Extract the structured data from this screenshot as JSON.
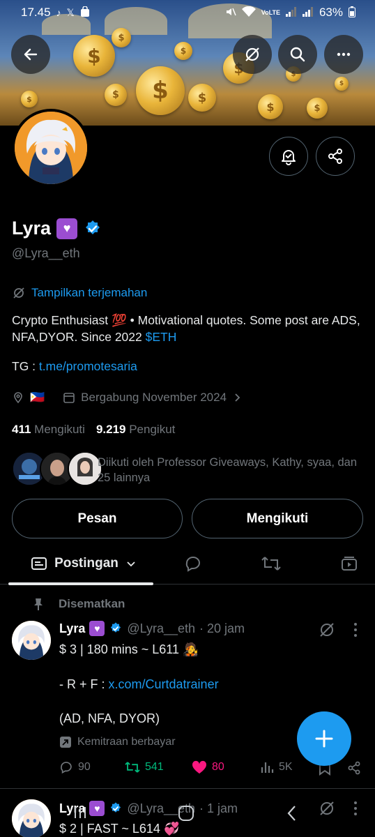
{
  "status_bar": {
    "time": "17.45",
    "battery": "63%",
    "network_label": "VoLTE"
  },
  "profile": {
    "name": "Lyra",
    "handle": "@Lyra__eth",
    "translate_label": "Tampilkan terjemahan",
    "bio_text": "Crypto Enthusiast 💯 • Motivational quotes. Some post are ADS, NFA,DYOR. Since 2022 ",
    "bio_cashtag": "$ETH",
    "tg_label": "TG : ",
    "tg_link": "t.me/promotesaria",
    "location_flag": "🇵🇭",
    "joined": "Bergabung November 2024",
    "following_count": "411",
    "following_label": "Mengikuti",
    "followers_count": "9.219",
    "followers_label": "Pengikut",
    "followed_by": "Diikuti oleh Professor Giveaways, Kathy, syaa, dan 25 lainnya"
  },
  "buttons": {
    "message": "Pesan",
    "following": "Mengikuti"
  },
  "tabs": {
    "posts": "Postingan"
  },
  "pinned_label": "Disematkan",
  "tweets": [
    {
      "name": "Lyra",
      "handle": "@Lyra__eth",
      "time": "· 20 jam",
      "line1": "$ 3 | 180 mins ~ L611 🧑‍🎤",
      "line2_prefix": "- R + F : ",
      "line2_link": "x.com/Curtdatrainer",
      "line3": "(AD, NFA, DYOR)",
      "paid_label": "Kemitraan berbayar",
      "replies": "90",
      "reposts": "541",
      "likes": "80",
      "views": "5K"
    },
    {
      "name": "Lyra",
      "handle": "@Lyra__eth",
      "time": "· 1 jam",
      "line1": "$ 2 | FAST ~ L614 💞"
    }
  ],
  "colors": {
    "accent": "#1d9bf0",
    "repost_green": "#00ba7c",
    "like_pink": "#f91880",
    "muted": "#71767b"
  }
}
